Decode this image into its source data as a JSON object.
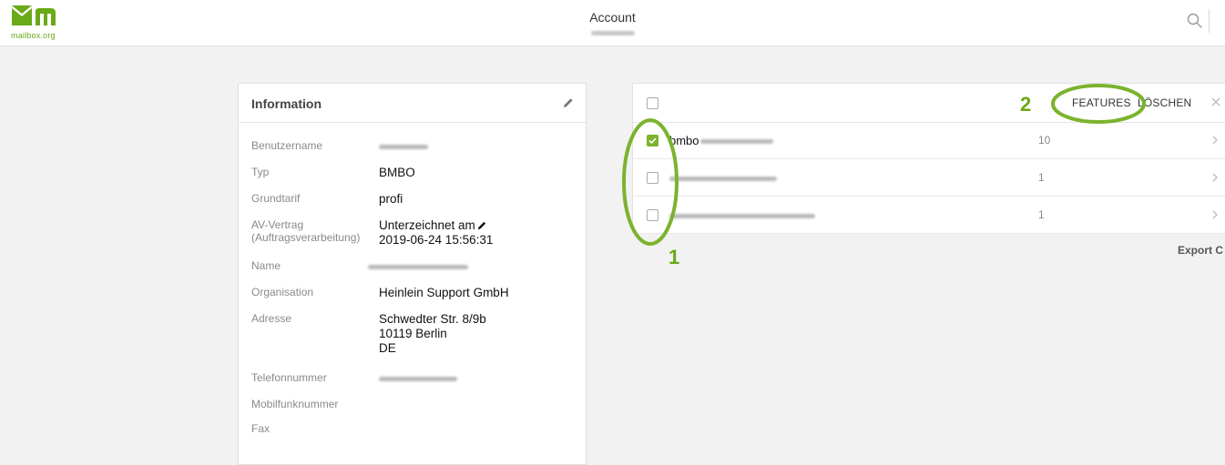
{
  "brand": {
    "logo_text": "mailbox.org",
    "accent": "#6aa917"
  },
  "header": {
    "title": "Account"
  },
  "info": {
    "title": "Information",
    "rows": [
      {
        "label": "Benutzername",
        "value": ""
      },
      {
        "label": "Typ",
        "value": "BMBO"
      },
      {
        "label": "Grundtarif",
        "value": "profi"
      },
      {
        "label": "AV-Vertrag (Auftragsverarbeitung)",
        "value_line1": "Unterzeichnet am",
        "value_line2": "2019-06-24 15:56:31"
      },
      {
        "label": "Name",
        "value": ""
      },
      {
        "label": "Organisation",
        "value": "Heinlein Support GmbH"
      },
      {
        "label": "Adresse",
        "value_line1": "Schwedter Str. 8/9b",
        "value_line2": "10119 Berlin",
        "value_line3": "DE"
      },
      {
        "label": "Telefonnummer",
        "value": ""
      },
      {
        "label": "Mobilfunknummer",
        "value": ""
      },
      {
        "label": "Fax",
        "value": ""
      }
    ]
  },
  "list": {
    "toolbar": {
      "features_label": "FEATURES",
      "delete_label": "LÖSCHEN"
    },
    "rows": [
      {
        "name_prefix": "bmbo",
        "count": "10",
        "checked": true
      },
      {
        "name_prefix": "",
        "count": "1",
        "checked": false
      },
      {
        "name_prefix": "",
        "count": "1",
        "checked": false
      }
    ],
    "export_label": "Export C"
  },
  "annotations": {
    "marker_1": "1",
    "marker_2": "2",
    "color": "#7bb32e"
  },
  "icons": [
    "logo-icon",
    "search-icon",
    "pencil-icon",
    "close-icon",
    "chevron-right-icon",
    "checkmark-icon"
  ]
}
